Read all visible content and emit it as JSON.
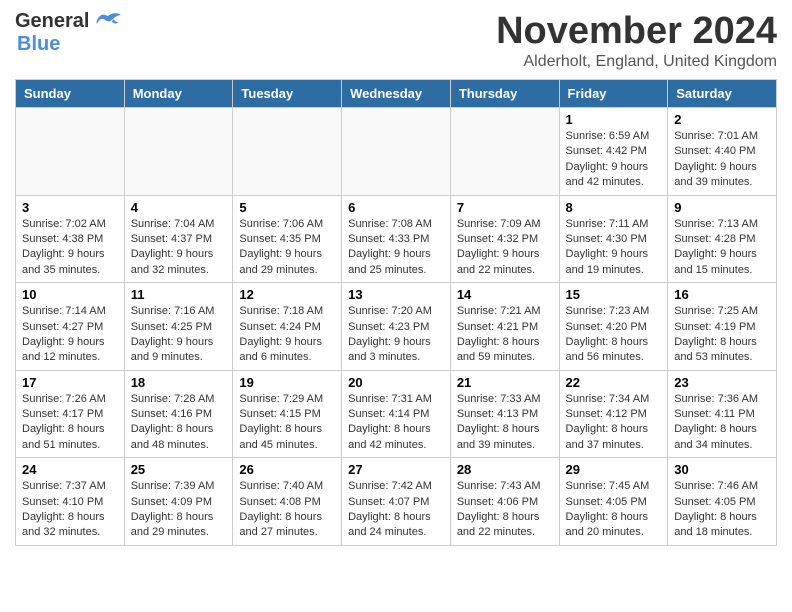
{
  "header": {
    "logo_general": "General",
    "logo_blue": "Blue",
    "month": "November 2024",
    "location": "Alderholt, England, United Kingdom"
  },
  "weekdays": [
    "Sunday",
    "Monday",
    "Tuesday",
    "Wednesday",
    "Thursday",
    "Friday",
    "Saturday"
  ],
  "weeks": [
    [
      {
        "day": "",
        "info": ""
      },
      {
        "day": "",
        "info": ""
      },
      {
        "day": "",
        "info": ""
      },
      {
        "day": "",
        "info": ""
      },
      {
        "day": "",
        "info": ""
      },
      {
        "day": "1",
        "info": "Sunrise: 6:59 AM\nSunset: 4:42 PM\nDaylight: 9 hours and 42 minutes."
      },
      {
        "day": "2",
        "info": "Sunrise: 7:01 AM\nSunset: 4:40 PM\nDaylight: 9 hours and 39 minutes."
      }
    ],
    [
      {
        "day": "3",
        "info": "Sunrise: 7:02 AM\nSunset: 4:38 PM\nDaylight: 9 hours and 35 minutes."
      },
      {
        "day": "4",
        "info": "Sunrise: 7:04 AM\nSunset: 4:37 PM\nDaylight: 9 hours and 32 minutes."
      },
      {
        "day": "5",
        "info": "Sunrise: 7:06 AM\nSunset: 4:35 PM\nDaylight: 9 hours and 29 minutes."
      },
      {
        "day": "6",
        "info": "Sunrise: 7:08 AM\nSunset: 4:33 PM\nDaylight: 9 hours and 25 minutes."
      },
      {
        "day": "7",
        "info": "Sunrise: 7:09 AM\nSunset: 4:32 PM\nDaylight: 9 hours and 22 minutes."
      },
      {
        "day": "8",
        "info": "Sunrise: 7:11 AM\nSunset: 4:30 PM\nDaylight: 9 hours and 19 minutes."
      },
      {
        "day": "9",
        "info": "Sunrise: 7:13 AM\nSunset: 4:28 PM\nDaylight: 9 hours and 15 minutes."
      }
    ],
    [
      {
        "day": "10",
        "info": "Sunrise: 7:14 AM\nSunset: 4:27 PM\nDaylight: 9 hours and 12 minutes."
      },
      {
        "day": "11",
        "info": "Sunrise: 7:16 AM\nSunset: 4:25 PM\nDaylight: 9 hours and 9 minutes."
      },
      {
        "day": "12",
        "info": "Sunrise: 7:18 AM\nSunset: 4:24 PM\nDaylight: 9 hours and 6 minutes."
      },
      {
        "day": "13",
        "info": "Sunrise: 7:20 AM\nSunset: 4:23 PM\nDaylight: 9 hours and 3 minutes."
      },
      {
        "day": "14",
        "info": "Sunrise: 7:21 AM\nSunset: 4:21 PM\nDaylight: 8 hours and 59 minutes."
      },
      {
        "day": "15",
        "info": "Sunrise: 7:23 AM\nSunset: 4:20 PM\nDaylight: 8 hours and 56 minutes."
      },
      {
        "day": "16",
        "info": "Sunrise: 7:25 AM\nSunset: 4:19 PM\nDaylight: 8 hours and 53 minutes."
      }
    ],
    [
      {
        "day": "17",
        "info": "Sunrise: 7:26 AM\nSunset: 4:17 PM\nDaylight: 8 hours and 51 minutes."
      },
      {
        "day": "18",
        "info": "Sunrise: 7:28 AM\nSunset: 4:16 PM\nDaylight: 8 hours and 48 minutes."
      },
      {
        "day": "19",
        "info": "Sunrise: 7:29 AM\nSunset: 4:15 PM\nDaylight: 8 hours and 45 minutes."
      },
      {
        "day": "20",
        "info": "Sunrise: 7:31 AM\nSunset: 4:14 PM\nDaylight: 8 hours and 42 minutes."
      },
      {
        "day": "21",
        "info": "Sunrise: 7:33 AM\nSunset: 4:13 PM\nDaylight: 8 hours and 39 minutes."
      },
      {
        "day": "22",
        "info": "Sunrise: 7:34 AM\nSunset: 4:12 PM\nDaylight: 8 hours and 37 minutes."
      },
      {
        "day": "23",
        "info": "Sunrise: 7:36 AM\nSunset: 4:11 PM\nDaylight: 8 hours and 34 minutes."
      }
    ],
    [
      {
        "day": "24",
        "info": "Sunrise: 7:37 AM\nSunset: 4:10 PM\nDaylight: 8 hours and 32 minutes."
      },
      {
        "day": "25",
        "info": "Sunrise: 7:39 AM\nSunset: 4:09 PM\nDaylight: 8 hours and 29 minutes."
      },
      {
        "day": "26",
        "info": "Sunrise: 7:40 AM\nSunset: 4:08 PM\nDaylight: 8 hours and 27 minutes."
      },
      {
        "day": "27",
        "info": "Sunrise: 7:42 AM\nSunset: 4:07 PM\nDaylight: 8 hours and 24 minutes."
      },
      {
        "day": "28",
        "info": "Sunrise: 7:43 AM\nSunset: 4:06 PM\nDaylight: 8 hours and 22 minutes."
      },
      {
        "day": "29",
        "info": "Sunrise: 7:45 AM\nSunset: 4:05 PM\nDaylight: 8 hours and 20 minutes."
      },
      {
        "day": "30",
        "info": "Sunrise: 7:46 AM\nSunset: 4:05 PM\nDaylight: 8 hours and 18 minutes."
      }
    ]
  ]
}
